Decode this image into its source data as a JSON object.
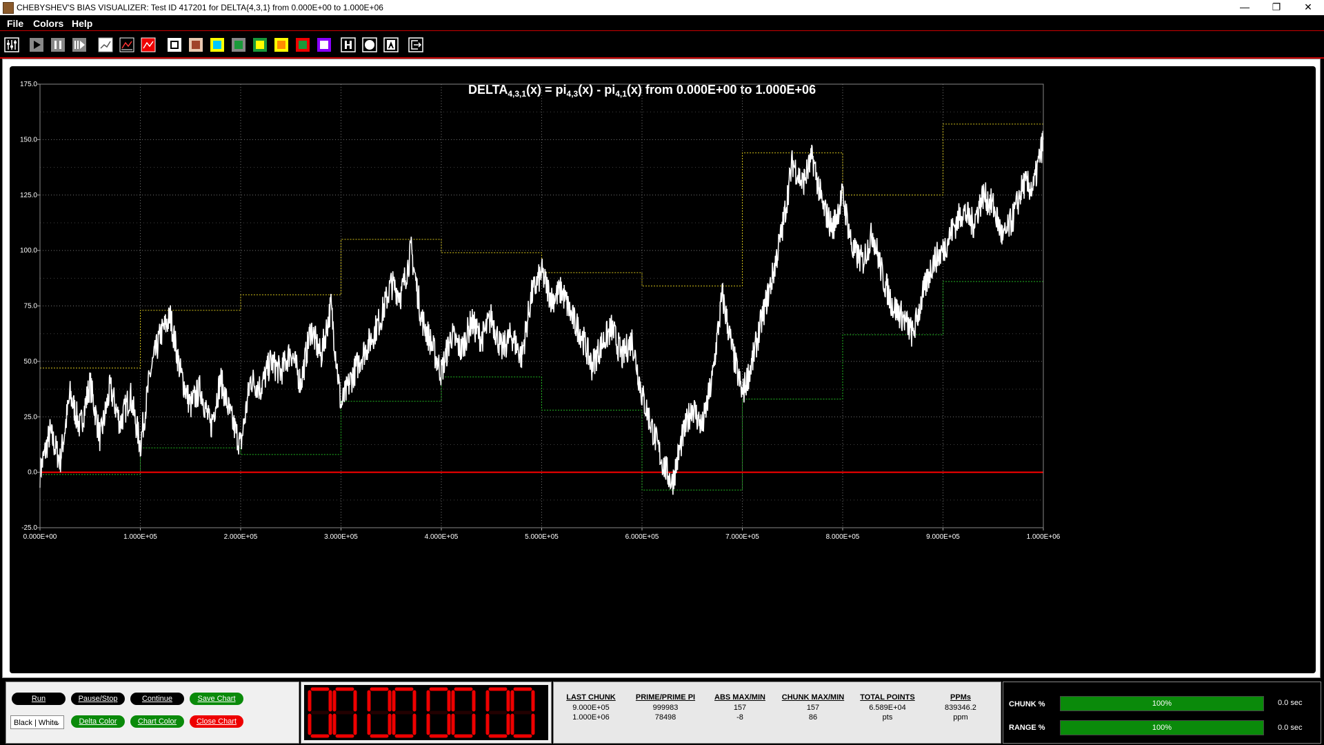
{
  "window": {
    "title": "CHEBYSHEV'S BIAS VISUALIZER: Test ID 417201 for DELTA{4,3,1} from 0.000E+00 to 1.000E+06",
    "minimize": "—",
    "restore": "❐",
    "close": "✕"
  },
  "menu": {
    "file": "File",
    "colors": "Colors",
    "help": "Help"
  },
  "toolbar": {
    "icons": [
      "settings-sliders-icon",
      "play-icon",
      "pause-icon",
      "step-forward-icon",
      "line-chart-white-icon",
      "line-chart-dark-icon",
      "line-chart-red-icon",
      "color-white-icon",
      "color-brown-icon",
      "color-cyan-icon",
      "color-green-icon",
      "color-yellow-icon",
      "color-orange-icon",
      "color-red-green-icon",
      "color-purple-icon",
      "h-icon",
      "circle-icon",
      "a-icon",
      "exit-icon"
    ],
    "swatches": {
      "white": "#ffffff",
      "brown": "#a0442a",
      "cyan": "#00c8ff",
      "green": "#1a9a3a",
      "yellow": "#ffff00",
      "orange": "#ff8c00",
      "redgreen": "#1a9a3a",
      "purple": "#8a00ff"
    }
  },
  "chart": {
    "title_main": "DELTA",
    "title_sub1": "4,3,1",
    "title_mid1": "(x) = pi",
    "title_sub2": "4,3",
    "title_mid2": "(x) - pi",
    "title_sub3": "4,1",
    "title_tail": "(x) from 0.000E+00 to 1.000E+06",
    "colors": {
      "trace": "#ffffff",
      "zero_line": "#ff0000",
      "max_line": "#d4c21a",
      "min_line": "#22bb22",
      "grid": "#777777",
      "bg": "#000000"
    }
  },
  "chart_data": {
    "type": "line",
    "title": "DELTA4,3,1(x) = pi4,3(x) - pi4,1(x) from 0.000E+00 to 1.000E+06",
    "xlim": [
      0,
      1000000
    ],
    "ylim": [
      -25,
      175
    ],
    "x_ticks": [
      "0.000E+00",
      "1.000E+05",
      "2.000E+05",
      "3.000E+05",
      "4.000E+05",
      "5.000E+05",
      "6.000E+05",
      "7.000E+05",
      "8.000E+05",
      "9.000E+05",
      "1.000E+06"
    ],
    "y_ticks": [
      "-25.0",
      "0.0",
      "25.0",
      "50.0",
      "75.0",
      "100.0",
      "125.0",
      "150.0",
      "175.0"
    ],
    "grid": true,
    "series": [
      {
        "x": [
          0,
          10000,
          20000,
          30000,
          40000,
          50000,
          60000,
          70000,
          80000,
          90000,
          100000,
          110000,
          120000,
          130000,
          140000,
          150000,
          160000,
          170000,
          180000,
          190000,
          200000,
          210000,
          220000,
          230000,
          240000,
          250000,
          260000,
          270000,
          280000,
          290000,
          300000,
          310000,
          320000,
          330000,
          340000,
          350000,
          360000,
          370000,
          380000,
          390000,
          400000,
          410000,
          420000,
          430000,
          440000,
          450000,
          460000,
          470000,
          480000,
          490000,
          500000,
          510000,
          520000,
          530000,
          540000,
          550000,
          560000,
          570000,
          580000,
          590000,
          600000,
          610000,
          620000,
          630000,
          640000,
          650000,
          660000,
          670000,
          680000,
          690000,
          700000,
          710000,
          720000,
          730000,
          740000,
          750000,
          760000,
          770000,
          780000,
          790000,
          800000,
          810000,
          820000,
          830000,
          840000,
          850000,
          860000,
          870000,
          880000,
          890000,
          900000,
          910000,
          920000,
          930000,
          940000,
          950000,
          960000,
          970000,
          980000,
          990000,
          1000000
        ],
        "values": [
          0,
          18,
          5,
          35,
          20,
          40,
          15,
          38,
          22,
          35,
          12,
          45,
          62,
          70,
          45,
          30,
          38,
          20,
          42,
          25,
          12,
          42,
          38,
          50,
          45,
          55,
          40,
          65,
          52,
          75,
          30,
          42,
          52,
          60,
          70,
          85,
          80,
          100,
          70,
          58,
          45,
          62,
          55,
          68,
          60,
          70,
          55,
          62,
          52,
          80,
          90,
          78,
          82,
          70,
          62,
          48,
          58,
          65,
          52,
          60,
          35,
          20,
          5,
          -5,
          15,
          30,
          20,
          42,
          80,
          55,
          35,
          50,
          70,
          88,
          110,
          140,
          130,
          142,
          120,
          110,
          125,
          100,
          95,
          108,
          88,
          75,
          70,
          62,
          80,
          95,
          100,
          110,
          118,
          112,
          125,
          120,
          105,
          115,
          130,
          128,
          150
        ]
      }
    ],
    "max_steps": {
      "x": [
        0,
        100000,
        200000,
        300000,
        400000,
        500000,
        600000,
        700000,
        800000,
        900000,
        1000000
      ],
      "values": [
        47,
        73,
        80,
        105,
        99,
        90,
        84,
        144,
        125,
        157
      ]
    },
    "min_steps": {
      "x": [
        0,
        100000,
        200000,
        300000,
        400000,
        500000,
        600000,
        700000,
        800000,
        900000,
        1000000
      ],
      "values": [
        -1,
        11,
        8,
        32,
        43,
        28,
        -8,
        33,
        62,
        86
      ]
    }
  },
  "controls": {
    "run": "Run",
    "pause": "Pause/Stop",
    "continue": "Continue",
    "save": "Save Chart",
    "select": "Black | White",
    "delta_color": "Delta Color",
    "chart_color": "Chart Color",
    "close": "Close Chart"
  },
  "timer": {
    "d1": "00",
    "d2": "00",
    "d3": "00",
    "d4": "00"
  },
  "stats": [
    {
      "h": "LAST CHUNK",
      "v1": "9.000E+05",
      "v2": "1.000E+06"
    },
    {
      "h": "PRIME/PRIME PI",
      "v1": "999983",
      "v2": "78498"
    },
    {
      "h": "ABS MAX/MIN",
      "v1": "157",
      "v2": "-8"
    },
    {
      "h": "CHUNK MAX/MIN",
      "v1": "157",
      "v2": "86"
    },
    {
      "h": "TOTAL POINTS",
      "v1": "6.589E+04",
      "v2": "pts"
    },
    {
      "h": "PPMs",
      "v1": "839346.2",
      "v2": "ppm"
    }
  ],
  "progress": {
    "chunk_label": "CHUNK %",
    "chunk_value": "100%",
    "chunk_fraction": 1.0,
    "chunk_time": "0.0 sec",
    "range_label": "RANGE %",
    "range_value": "100%",
    "range_fraction": 1.0,
    "range_time": "0.0 sec"
  }
}
